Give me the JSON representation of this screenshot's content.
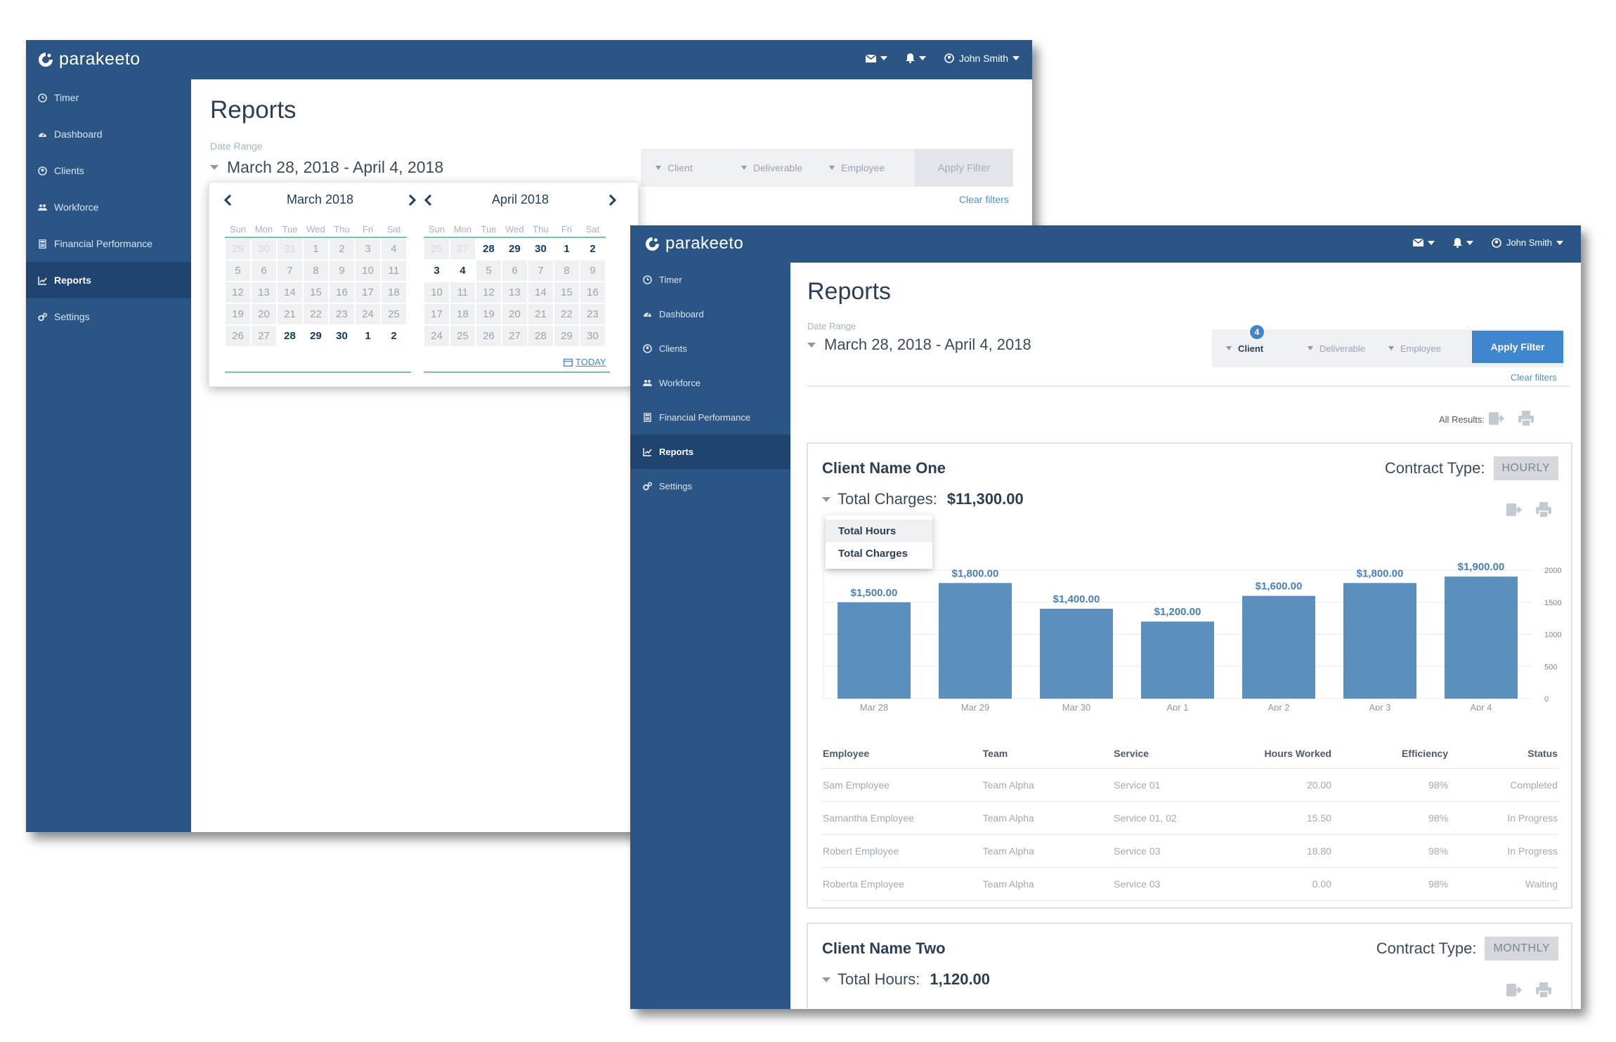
{
  "app": {
    "brand": "parakeeto",
    "user_name": "John Smith"
  },
  "nav": [
    {
      "label": "Timer",
      "icon": "clock-icon"
    },
    {
      "label": "Dashboard",
      "icon": "gauge-icon"
    },
    {
      "label": "Clients",
      "icon": "user-circle-icon"
    },
    {
      "label": "Workforce",
      "icon": "users-icon"
    },
    {
      "label": "Financial Performance",
      "icon": "calculator-icon"
    },
    {
      "label": "Reports",
      "icon": "line-chart-icon",
      "active": true
    },
    {
      "label": "Settings",
      "icon": "cogs-icon"
    }
  ],
  "page": {
    "title": "Reports",
    "date_range_label": "Date Range",
    "date_range_value": "March 28, 2018 - April 4, 2018"
  },
  "filters": {
    "client": "Client",
    "deliverable": "Deliverable",
    "employee": "Employee",
    "apply": "Apply Filter",
    "clear": "Clear filters",
    "client_badge": "4"
  },
  "calendar": {
    "dow": [
      "Sun",
      "Mon",
      "Tue",
      "Wed",
      "Thu",
      "Fri",
      "Sat"
    ],
    "today_label": "TODAY",
    "months": [
      {
        "title": "March 2018",
        "days": [
          [
            "29",
            0
          ],
          [
            "30",
            0
          ],
          [
            "31",
            0
          ],
          [
            "1",
            1
          ],
          [
            "2",
            1
          ],
          [
            "3",
            1
          ],
          [
            "4",
            1
          ],
          [
            "5",
            1
          ],
          [
            "6",
            1
          ],
          [
            "7",
            1
          ],
          [
            "8",
            1
          ],
          [
            "9",
            1
          ],
          [
            "10",
            1
          ],
          [
            "11",
            1
          ],
          [
            "12",
            1
          ],
          [
            "13",
            1
          ],
          [
            "14",
            1
          ],
          [
            "15",
            1
          ],
          [
            "16",
            1
          ],
          [
            "17",
            1
          ],
          [
            "18",
            1
          ],
          [
            "19",
            1
          ],
          [
            "20",
            1
          ],
          [
            "21",
            1
          ],
          [
            "22",
            1
          ],
          [
            "23",
            1
          ],
          [
            "24",
            1
          ],
          [
            "25",
            1
          ],
          [
            "26",
            1
          ],
          [
            "27",
            1
          ],
          [
            "28",
            2
          ],
          [
            "29",
            2
          ],
          [
            "30",
            2
          ],
          [
            "1",
            2
          ],
          [
            "2",
            2
          ]
        ]
      },
      {
        "title": "April 2018",
        "days": [
          [
            "25",
            0
          ],
          [
            "27",
            0
          ],
          [
            "28",
            2
          ],
          [
            "29",
            2
          ],
          [
            "30",
            2
          ],
          [
            "1",
            2
          ],
          [
            "2",
            2
          ],
          [
            "3",
            2
          ],
          [
            "4",
            2
          ],
          [
            "5",
            1
          ],
          [
            "6",
            1
          ],
          [
            "7",
            1
          ],
          [
            "8",
            1
          ],
          [
            "9",
            1
          ],
          [
            "10",
            1
          ],
          [
            "11",
            1
          ],
          [
            "12",
            1
          ],
          [
            "13",
            1
          ],
          [
            "14",
            1
          ],
          [
            "15",
            1
          ],
          [
            "16",
            1
          ],
          [
            "17",
            1
          ],
          [
            "18",
            1
          ],
          [
            "19",
            1
          ],
          [
            "20",
            1
          ],
          [
            "21",
            1
          ],
          [
            "22",
            1
          ],
          [
            "23",
            1
          ],
          [
            "24",
            1
          ],
          [
            "25",
            1
          ],
          [
            "26",
            1
          ],
          [
            "27",
            1
          ],
          [
            "28",
            1
          ],
          [
            "29",
            1
          ],
          [
            "30",
            1
          ]
        ]
      }
    ]
  },
  "results_label": "All Results:",
  "clients": [
    {
      "name": "Client Name One",
      "contract_label": "Contract Type:",
      "contract_type": "HOURLY",
      "total_label": "Total Charges:",
      "total_value": "$11,300.00"
    },
    {
      "name": "Client Name Two",
      "contract_label": "Contract Type:",
      "contract_type": "MONTHLY",
      "total_label": "Total Hours:",
      "total_value": "1,120.00"
    }
  ],
  "metric_menu": [
    "Total Hours",
    "Total Charges"
  ],
  "chart_data": {
    "type": "bar",
    "categories": [
      "Mar 28",
      "Mar 29",
      "Mar 30",
      "Apr 1",
      "Apr 2",
      "Apr 3",
      "Apr 4"
    ],
    "values": [
      1500,
      1800,
      1400,
      1200,
      1600,
      1800,
      1900
    ],
    "data_labels": [
      "$1,500.00",
      "$1,800.00",
      "$1,400.00",
      "$1,200.00",
      "$1,600.00",
      "$1,800.00",
      "$1,900.00"
    ],
    "y_ticks": [
      "2000",
      "1500",
      "1000",
      "500",
      "0"
    ],
    "ylim": [
      0,
      2000
    ],
    "bar_color": "#5b8fbe",
    "grid": true,
    "axis_side": "right"
  },
  "table": {
    "headers": [
      "Employee",
      "Team",
      "Service",
      "Hours Worked",
      "Efficiency",
      "Status"
    ],
    "rows": [
      [
        "Sam Employee",
        "Team Alpha",
        "Service 01",
        "20.00",
        "98%",
        "Completed"
      ],
      [
        "Samantha Employee",
        "Team Alpha",
        "Service 01, 02",
        "15.50",
        "98%",
        "In Progress"
      ],
      [
        "Robert Employee",
        "Team Alpha",
        "Service 03",
        "18.80",
        "98%",
        "In Progress"
      ],
      [
        "Roberta Employee",
        "Team Alpha",
        "Service 03",
        "0.00",
        "98%",
        "Waiting"
      ]
    ]
  },
  "colors": {
    "nav_bg": "#2a5585",
    "nav_active": "#1f4470",
    "apply_active": "#3e87cf",
    "accent_teal": "#7bbfb3"
  }
}
